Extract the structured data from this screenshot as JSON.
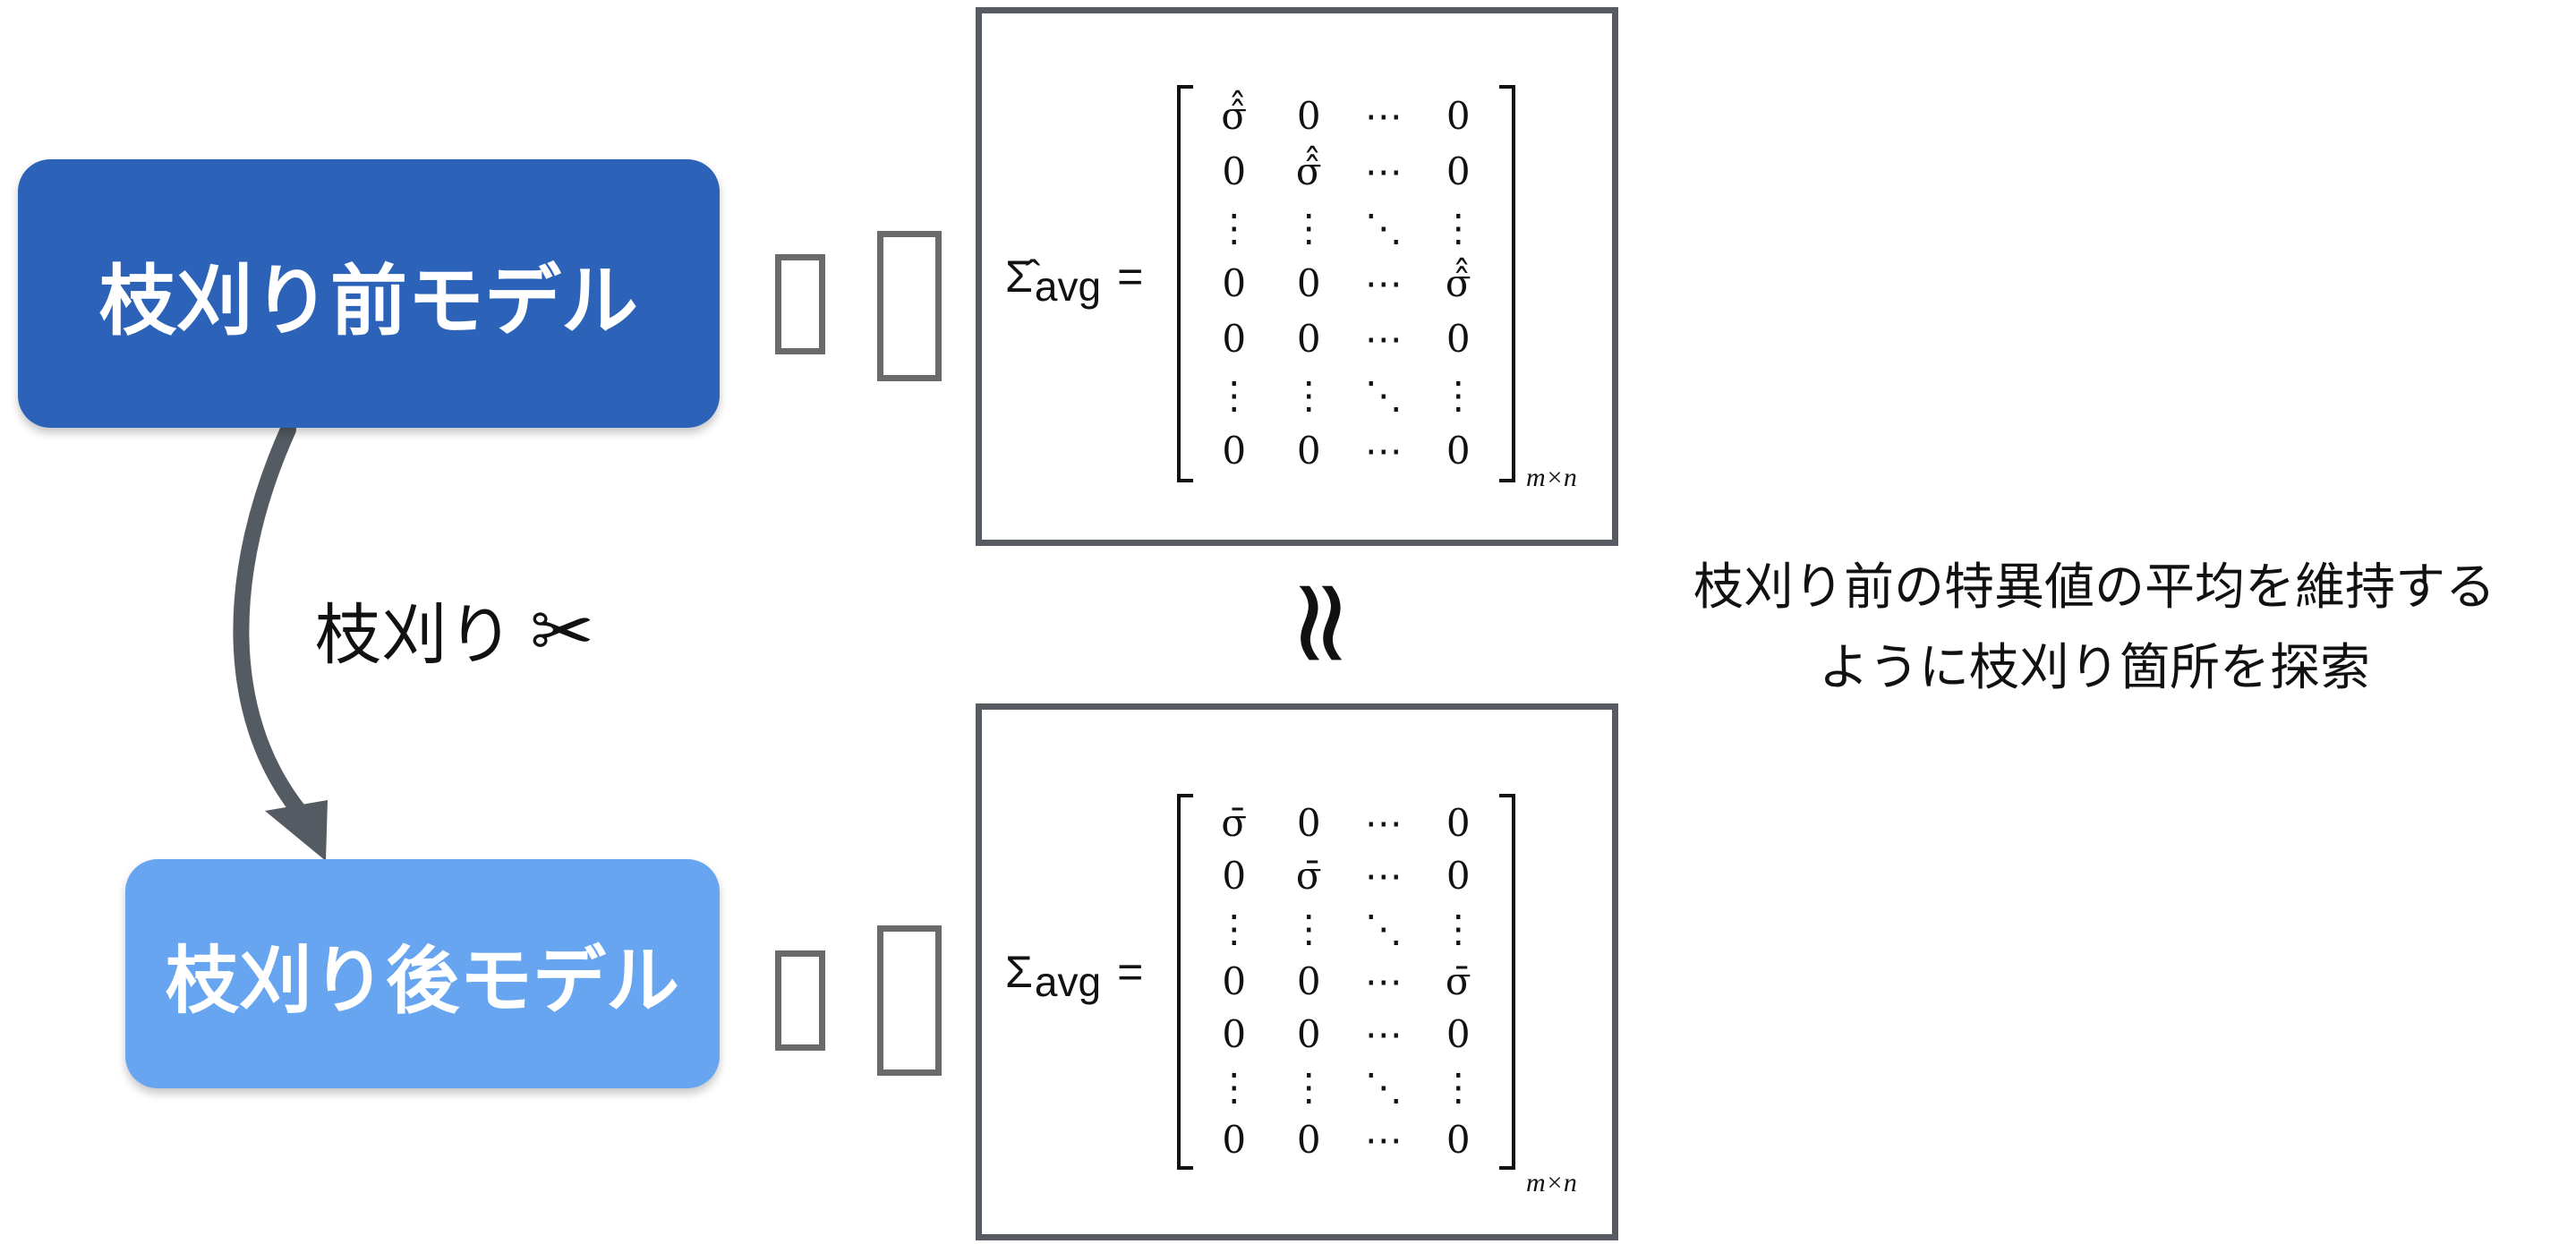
{
  "before_model": {
    "label": "枝刈り前モデル",
    "color": "#2c63b8"
  },
  "after_model": {
    "label": "枝刈り後モデル",
    "color": "#68a5f0"
  },
  "edge": {
    "label": "枝刈り",
    "icon": "scissors-icon",
    "glyph": "✂"
  },
  "matrix_before": {
    "lhs_symbol": "Σ̂",
    "lhs_subscript": "avg",
    "lhs_eq": "=",
    "rows": [
      [
        "σ̂̂",
        "0",
        "⋯",
        "0"
      ],
      [
        "0",
        "σ̂̂",
        "⋯",
        "0"
      ],
      [
        "⋮",
        "⋮",
        "⋱",
        "⋮"
      ],
      [
        "0",
        "0",
        "⋯",
        "σ̂̂"
      ],
      [
        "0",
        "0",
        "⋯",
        "0"
      ],
      [
        "⋮",
        "⋮",
        "⋱",
        "⋮"
      ],
      [
        "0",
        "0",
        "⋯",
        "0"
      ]
    ],
    "dims": "m×n"
  },
  "approx_symbol": "≈",
  "matrix_after": {
    "lhs_symbol": "Σ",
    "lhs_subscript": "avg",
    "lhs_eq": "=",
    "rows": [
      [
        "σ̄",
        "0",
        "⋯",
        "0"
      ],
      [
        "0",
        "σ̄",
        "⋯",
        "0"
      ],
      [
        "⋮",
        "⋮",
        "⋱",
        "⋮"
      ],
      [
        "0",
        "0",
        "⋯",
        "σ̄"
      ],
      [
        "0",
        "0",
        "⋯",
        "0"
      ],
      [
        "⋮",
        "⋮",
        "⋱",
        "⋮"
      ],
      [
        "0",
        "0",
        "⋯",
        "0"
      ]
    ],
    "dims": "m×n"
  },
  "note": {
    "line1": "枝刈り前の特異値の平均を維持する",
    "line2": "ように枝刈り箇所を探索"
  },
  "colors": {
    "frame": "#575b61",
    "arrow": "#555b62",
    "placeholder": "#6a6a6a"
  }
}
